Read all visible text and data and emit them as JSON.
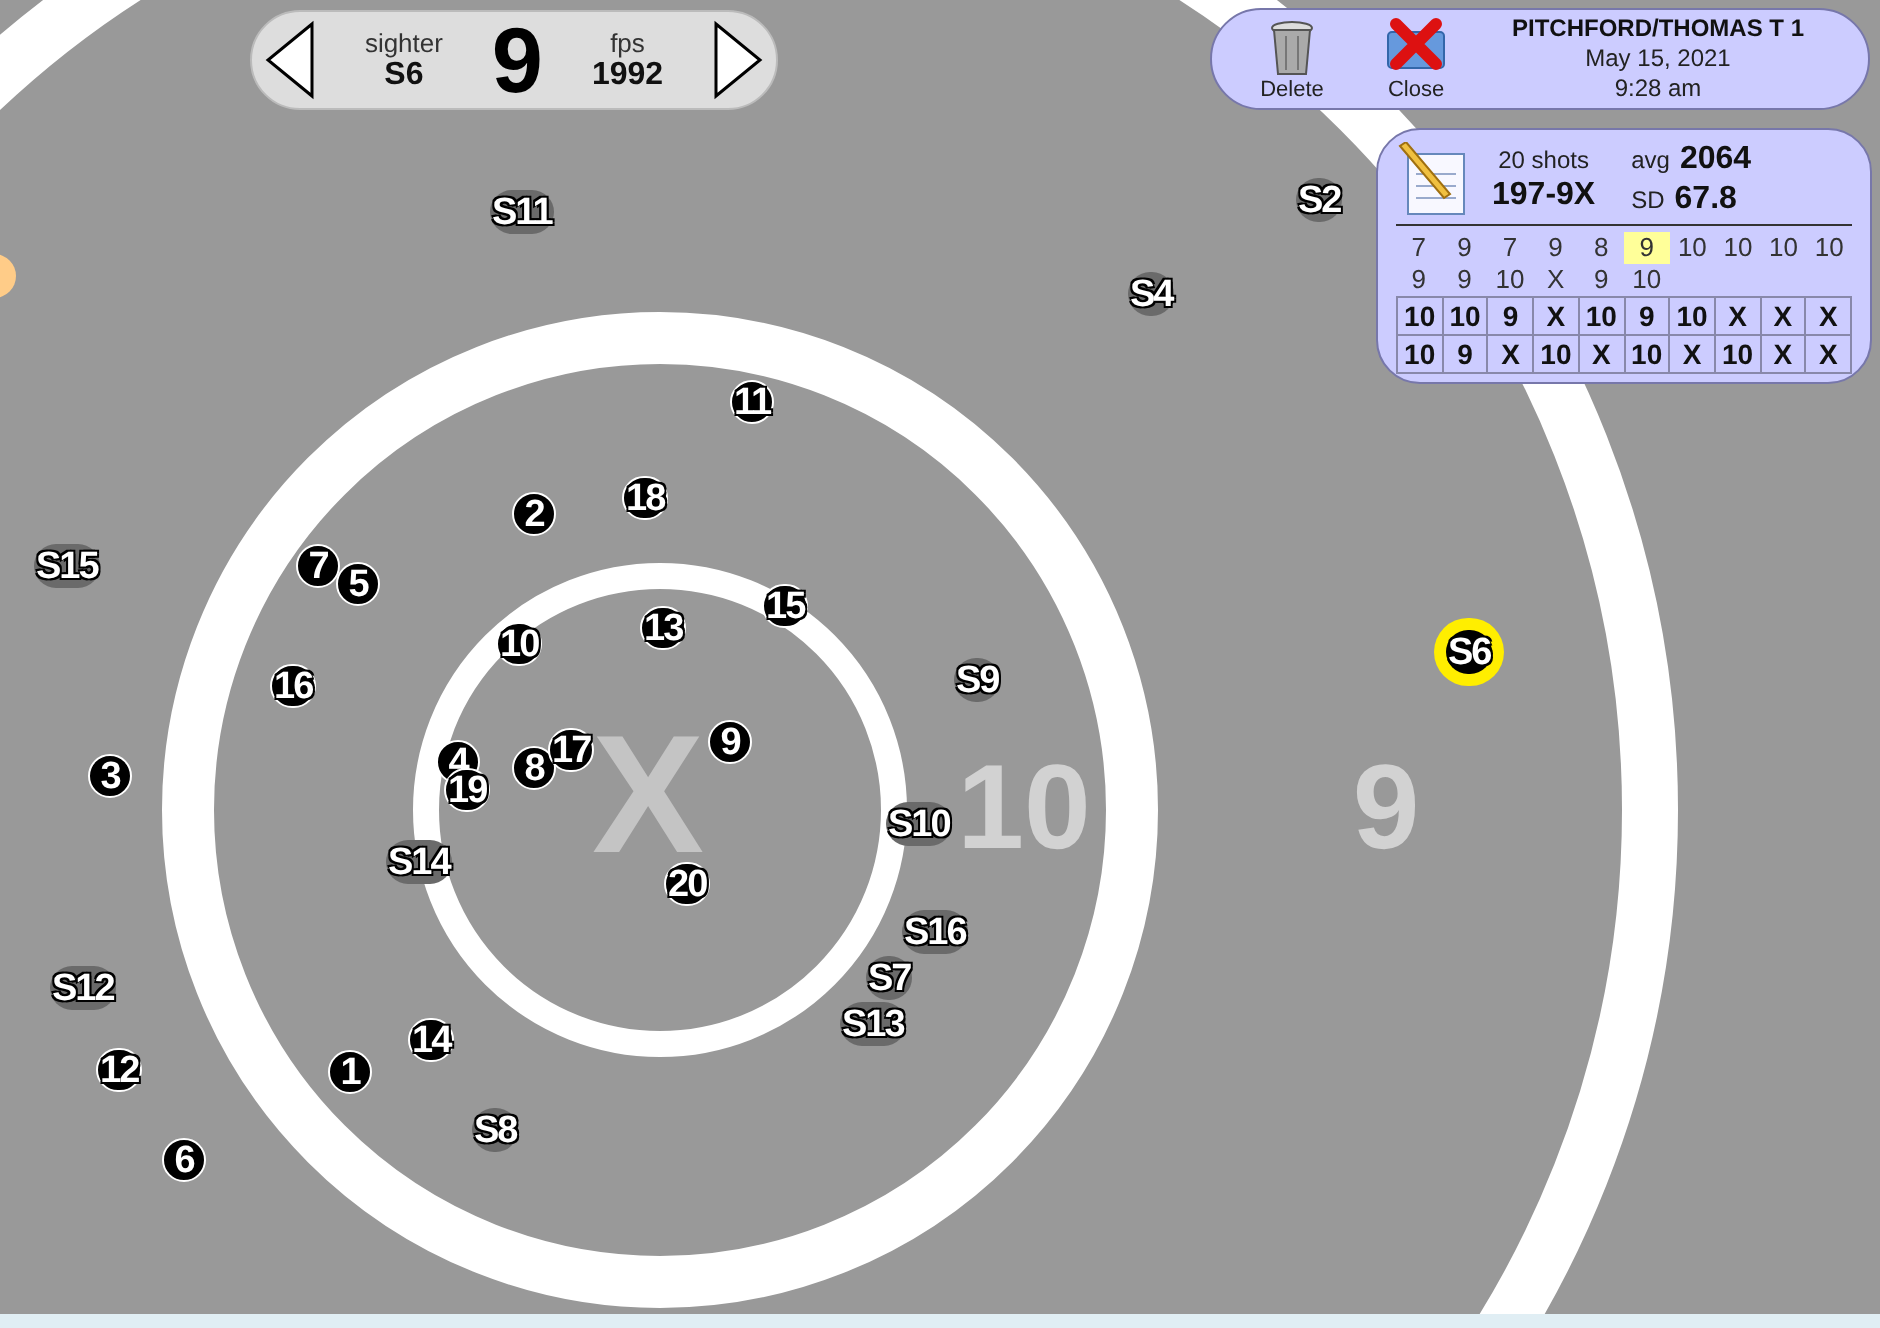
{
  "navigator": {
    "sighter_label": "sighter",
    "sighter_value": "S6",
    "score": "9",
    "fps_label": "fps",
    "fps_value": "1992"
  },
  "header": {
    "delete_label": "Delete",
    "close_label": "Close",
    "shooter": "PITCHFORD/THOMAS T 1",
    "date": "May 15, 2021",
    "time": "9:28 am"
  },
  "summary": {
    "shots_label": "20 shots",
    "total": "197-9X",
    "avg_label": "avg",
    "avg": "2064",
    "sd_label": "SD",
    "sd": "67.8",
    "sighter_scores": [
      {
        "value": "7",
        "selected": false
      },
      {
        "value": "9",
        "selected": false
      },
      {
        "value": "7",
        "selected": false
      },
      {
        "value": "9",
        "selected": false
      },
      {
        "value": "8",
        "selected": false
      },
      {
        "value": "9",
        "selected": true
      },
      {
        "value": "10",
        "selected": false
      },
      {
        "value": "10",
        "selected": false
      },
      {
        "value": "10",
        "selected": false
      },
      {
        "value": "10",
        "selected": false
      },
      {
        "value": "9",
        "selected": false
      },
      {
        "value": "9",
        "selected": false
      },
      {
        "value": "10",
        "selected": false
      },
      {
        "value": "X",
        "selected": false
      },
      {
        "value": "9",
        "selected": false
      },
      {
        "value": "10",
        "selected": false
      }
    ],
    "score_grid": [
      [
        "10",
        "10",
        "9",
        "X",
        "10",
        "9",
        "10",
        "X",
        "X",
        "X"
      ],
      [
        "10",
        "9",
        "X",
        "10",
        "X",
        "10",
        "X",
        "10",
        "X",
        "X"
      ]
    ]
  },
  "target": {
    "center_label": "X",
    "ring_labels": [
      "10",
      "9"
    ],
    "shots": [
      {
        "label": "S11",
        "kind": "sighter",
        "selected": false
      },
      {
        "label": "S2",
        "kind": "sighter",
        "selected": false
      },
      {
        "label": "S4",
        "kind": "sighter",
        "selected": false
      },
      {
        "label": "S15",
        "kind": "sighter",
        "selected": false
      },
      {
        "label": "S9",
        "kind": "sighter",
        "selected": false
      },
      {
        "label": "S10",
        "kind": "sighter",
        "selected": false
      },
      {
        "label": "S14",
        "kind": "sighter",
        "selected": false
      },
      {
        "label": "S16",
        "kind": "sighter",
        "selected": false
      },
      {
        "label": "S7",
        "kind": "sighter",
        "selected": false
      },
      {
        "label": "S13",
        "kind": "sighter",
        "selected": false
      },
      {
        "label": "S12",
        "kind": "sighter",
        "selected": false
      },
      {
        "label": "S8",
        "kind": "sighter",
        "selected": false
      },
      {
        "label": "S6",
        "kind": "sighter",
        "selected": true
      },
      {
        "label": "1",
        "kind": "record",
        "selected": false
      },
      {
        "label": "2",
        "kind": "record",
        "selected": false
      },
      {
        "label": "3",
        "kind": "record",
        "selected": false
      },
      {
        "label": "4",
        "kind": "record",
        "selected": false
      },
      {
        "label": "5",
        "kind": "record",
        "selected": false
      },
      {
        "label": "6",
        "kind": "record",
        "selected": false
      },
      {
        "label": "7",
        "kind": "record",
        "selected": false
      },
      {
        "label": "8",
        "kind": "record",
        "selected": false
      },
      {
        "label": "9",
        "kind": "record",
        "selected": false
      },
      {
        "label": "10",
        "kind": "record",
        "selected": false
      },
      {
        "label": "11",
        "kind": "record",
        "selected": false
      },
      {
        "label": "12",
        "kind": "record",
        "selected": false
      },
      {
        "label": "13",
        "kind": "record",
        "selected": false
      },
      {
        "label": "14",
        "kind": "record",
        "selected": false
      },
      {
        "label": "15",
        "kind": "record",
        "selected": false
      },
      {
        "label": "16",
        "kind": "record",
        "selected": false
      },
      {
        "label": "17",
        "kind": "record",
        "selected": false
      },
      {
        "label": "18",
        "kind": "record",
        "selected": false
      },
      {
        "label": "19",
        "kind": "record",
        "selected": false
      },
      {
        "label": "20",
        "kind": "record",
        "selected": false
      }
    ]
  }
}
